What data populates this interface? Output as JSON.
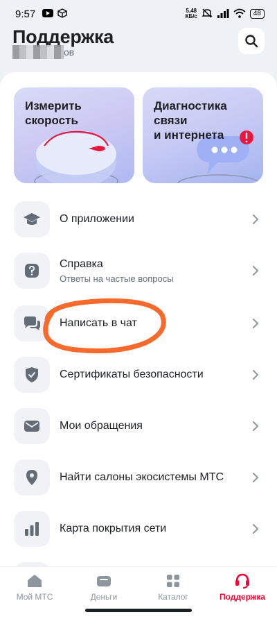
{
  "status_bar": {
    "time": "9:57",
    "net_speed_value": "5,48",
    "net_speed_unit": "КБ/с",
    "battery": "48"
  },
  "header": {
    "title": "Поддержка",
    "subtitle_visible": "ов"
  },
  "cards": [
    {
      "title": "Измерить\nскорость"
    },
    {
      "title": "Диагностика\nсвязи\nи интернета"
    }
  ],
  "menu": [
    {
      "label": "О приложении",
      "sub": "",
      "icon": "graduation-cap-icon"
    },
    {
      "label": "Справка",
      "sub": "Ответы на частые вопросы",
      "icon": "question-icon"
    },
    {
      "label": "Написать в чат",
      "sub": "",
      "icon": "chat-icon"
    },
    {
      "label": "Сертификаты безопасности",
      "sub": "",
      "icon": "shield-icon"
    },
    {
      "label": "Мои обращения",
      "sub": "",
      "icon": "envelope-icon"
    },
    {
      "label": "Найти салоны экосистемы МТС",
      "sub": "",
      "icon": "map-pin-icon"
    },
    {
      "label": "Карта покрытия сети",
      "sub": "",
      "icon": "bar-chart-icon"
    }
  ],
  "bottom_nav": [
    {
      "label": "Мой МТС",
      "icon": "home-icon",
      "active": false
    },
    {
      "label": "Деньги",
      "icon": "wallet-icon",
      "active": false
    },
    {
      "label": "Каталог",
      "icon": "grid-icon",
      "active": false
    },
    {
      "label": "Поддержка",
      "icon": "headset-icon",
      "active": true
    }
  ],
  "colors": {
    "accent": "#ff0032",
    "annotation": "#f86a2c",
    "icon_gray": "#626c77",
    "text": "#1d2023"
  }
}
